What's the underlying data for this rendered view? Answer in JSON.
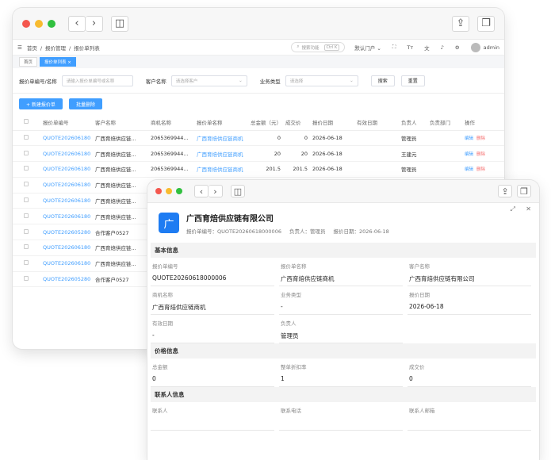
{
  "list": {
    "crumbs": [
      "首页",
      "报价管理",
      "报价单列表"
    ],
    "search_label": "搜索功能",
    "search_kbd": "Ctrl K",
    "portal": "默认门户",
    "user": "admin",
    "tabs": [
      "首页",
      "报价单列表 ×"
    ],
    "filters": [
      {
        "label": "报价单编号/名称",
        "ph": "请输入报价单编号或名称"
      },
      {
        "label": "客户名称",
        "ph": "请选择客户"
      },
      {
        "label": "业务类型",
        "ph": "请选择"
      }
    ],
    "search_btn": "搜索",
    "reset_btn": "重置",
    "new_btn": "+ 新建报价单",
    "batch_del_btn": "批量删除",
    "columns": [
      "报价单编号",
      "客户名称",
      "商机名称",
      "报价单名称",
      "总金额（元）",
      "成交价",
      "报价日期",
      "有效日期",
      "负责人",
      "负责部门",
      "操作"
    ],
    "edit": "编辑",
    "del": "删除",
    "rows": [
      [
        "QUOTE202606180",
        "广西育焙供应链...",
        "2065369944...",
        "广西育焙供应链商机",
        "0",
        "0",
        "2026-06-18",
        "",
        "管理员",
        ""
      ],
      [
        "QUOTE202606180",
        "广西育焙供应链...",
        "2065369944...",
        "广西育焙供应链商机",
        "20",
        "20",
        "2026-06-18",
        "",
        "王建元",
        ""
      ],
      [
        "QUOTE202606180",
        "广西育焙供应链...",
        "2065369944...",
        "广西育焙供应链商机",
        "201.5",
        "201.5",
        "2026-06-18",
        "",
        "管理员",
        ""
      ],
      [
        "QUOTE202606180",
        "广西育焙供应链...",
        "",
        "",
        "",
        "",
        "",
        "",
        "",
        ""
      ],
      [
        "QUOTE202606180",
        "广西育焙供应链...",
        "",
        "",
        "",
        "",
        "",
        "",
        "",
        ""
      ],
      [
        "QUOTE202606180",
        "广西育焙供应链...",
        "",
        "",
        "",
        "",
        "",
        "",
        "",
        ""
      ],
      [
        "QUOTE202605280",
        "合作客户0527",
        "",
        "",
        "",
        "",
        "",
        "",
        "",
        ""
      ],
      [
        "QUOTE202606180",
        "广西育焙供应链...",
        "",
        "",
        "",
        "",
        "",
        "",
        "",
        ""
      ],
      [
        "QUOTE202606180",
        "广西育焙供应链...",
        "",
        "",
        "",
        "",
        "",
        "",
        "",
        ""
      ],
      [
        "QUOTE202605280",
        "合作客户0527",
        "",
        "",
        "",
        "",
        "",
        "",
        "",
        ""
      ]
    ]
  },
  "detail": {
    "company": "广西育焙供应链有限公司",
    "logo_char": "广",
    "quote_no": "报价单编号：QUOTE20260618000006",
    "owner": "负责人：管理员",
    "date": "报价日期：2026-06-18",
    "sections": [
      {
        "title": "基本信息",
        "fields": [
          {
            "l": "报价单编号",
            "v": "QUOTE20260618000006"
          },
          {
            "l": "报价单名称",
            "v": "广西育焙供应链商机"
          },
          {
            "l": "客户名称",
            "v": "广西育焙供应链有限公司"
          },
          {
            "l": "商机名称",
            "v": "广西育焙供应链商机"
          },
          {
            "l": "业务类型",
            "v": "-"
          },
          {
            "l": "报价日期",
            "v": "2026-06-18"
          },
          {
            "l": "有效日期",
            "v": "-"
          },
          {
            "l": "负责人",
            "v": "管理员"
          }
        ]
      },
      {
        "title": "价格信息",
        "fields": [
          {
            "l": "总金额",
            "v": "0"
          },
          {
            "l": "整单折扣率",
            "v": "1"
          },
          {
            "l": "成交价",
            "v": "0"
          }
        ]
      },
      {
        "title": "联系人信息",
        "fields": [
          {
            "l": "联系人",
            "v": ""
          },
          {
            "l": "联系电话",
            "v": ""
          },
          {
            "l": "联系人邮箱",
            "v": ""
          }
        ]
      }
    ]
  }
}
